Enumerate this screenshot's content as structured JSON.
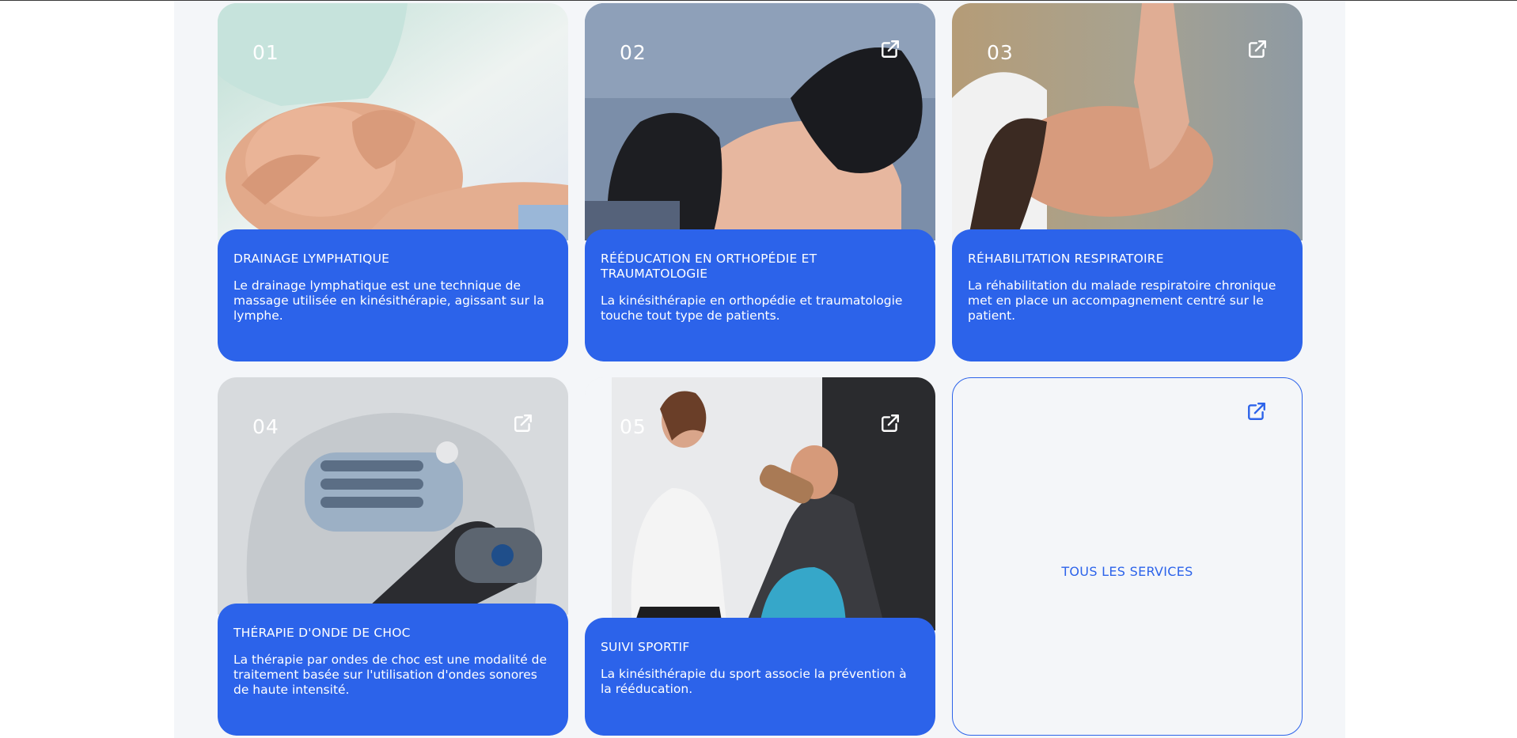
{
  "colors": {
    "accent": "#2c63ea",
    "panel_background": "#f4f6f9",
    "page_background": "#ffffff",
    "card_text": "#ffffff"
  },
  "services": [
    {
      "number": "01",
      "title": "DRAINAGE LYMPHATIQUE",
      "description": "Le drainage lymphatique est une technique de massage utilisée en kinésithérapie, agissant sur la lymphe.",
      "image": "photo of hands massaging a knee",
      "icon": "external-link-icon"
    },
    {
      "number": "02",
      "title": "RÉÉDUCATION EN ORTHOPÉDIE ET TRAUMATOLOGIE",
      "description": "La kinésithérapie en orthopédie et traumatologie touche tout type de patients.",
      "image": "photo of black-gloved hands holding a foot",
      "icon": "external-link-icon"
    },
    {
      "number": "03",
      "title": "RÉHABILITATION RESPIRATOIRE",
      "description": "La réhabilitation du malade respiratoire chronique met en place un accompagnement centré sur le patient.",
      "image": "photo of a woman receiving a face massage",
      "icon": "external-link-icon"
    },
    {
      "number": "04",
      "title": "THÉRAPIE D'ONDE DE CHOC",
      "description": "La thérapie par ondes de choc est une modalité de traitement basée sur l'utilisation d'ondes sonores de haute intensité.",
      "image": "photo of a shockwave therapy device",
      "icon": "external-link-icon"
    },
    {
      "number": "05",
      "title": "SUIVI SPORTIF",
      "description": "La kinésithérapie du sport associe la prévention à la rééducation.",
      "image": "photo of a therapist assisting a man on a training machine",
      "icon": "external-link-icon"
    }
  ],
  "all_services": {
    "label": "TOUS LES SERVICES",
    "icon": "external-link-icon"
  }
}
